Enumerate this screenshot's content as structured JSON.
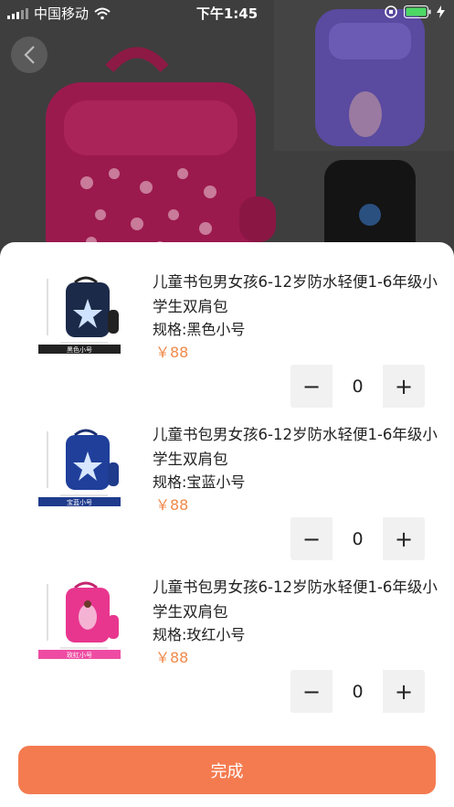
{
  "status_bar": {
    "carrier": "中国移动",
    "time": "下午1:45"
  },
  "products": [
    {
      "title": "儿童书包男女孩6-12岁防水轻便1-6年级小学生双肩包",
      "spec": "规格:黑色小号",
      "price": "￥88",
      "quantity": "0",
      "thumb_caption": "黑色小号",
      "thumb_color": "#1c2a4a",
      "caption_bg": "#222222"
    },
    {
      "title": "儿童书包男女孩6-12岁防水轻便1-6年级小学生双肩包",
      "spec": "规格:宝蓝小号",
      "price": "￥88",
      "quantity": "0",
      "thumb_caption": "宝蓝小号",
      "thumb_color": "#1f3f9a",
      "caption_bg": "#1f3b8c"
    },
    {
      "title": "儿童书包男女孩6-12岁防水轻便1-6年级小学生双肩包",
      "spec": "规格:玫红小号",
      "price": "￥88",
      "quantity": "0",
      "thumb_caption": "玫红小号",
      "thumb_color": "#e8368f",
      "caption_bg": "#ee4ca2"
    }
  ],
  "stepper": {
    "minus": "−",
    "plus": "+"
  },
  "done_label": "完成",
  "colors": {
    "accent": "#f47b50",
    "price": "#f08a4b"
  },
  "icons": [
    "signal-icon",
    "wifi-icon",
    "orientation-lock-icon",
    "battery-icon",
    "charging-icon",
    "back-arrow-icon"
  ]
}
